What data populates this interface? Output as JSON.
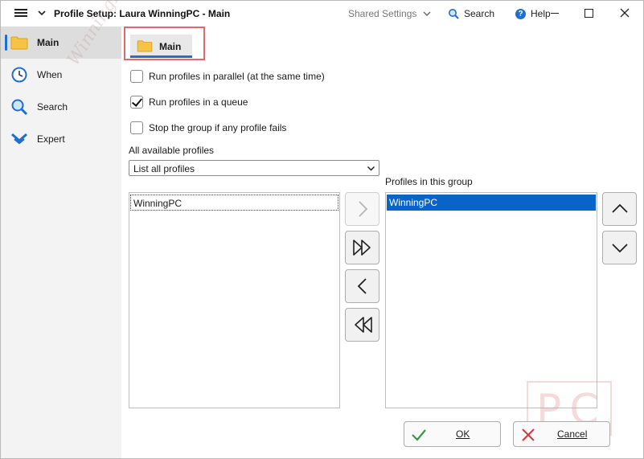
{
  "window": {
    "title": "Profile Setup: Laura WinningPC - Main",
    "shared_settings": "Shared Settings",
    "search": "Search",
    "help": "Help"
  },
  "sidebar": {
    "watermark": "WinningPC",
    "items": [
      {
        "label": "Main",
        "icon": "folder-icon",
        "active": true
      },
      {
        "label": "When",
        "icon": "clock-icon",
        "active": false
      },
      {
        "label": "Search",
        "icon": "magnifier-icon",
        "active": false
      },
      {
        "label": "Expert",
        "icon": "double-chevron-down-icon",
        "active": false
      }
    ]
  },
  "tab": {
    "label": "Main"
  },
  "options": {
    "parallel": {
      "label": "Run profiles in parallel (at the same time)",
      "checked": false
    },
    "queue": {
      "label": "Run profiles in a queue",
      "checked": true
    },
    "stop_on_fail": {
      "label": "Stop the group if any profile fails",
      "checked": false
    }
  },
  "available": {
    "label": "All available profiles",
    "filter_value": "List all profiles",
    "items": [
      "WinningPC"
    ]
  },
  "group": {
    "label": "Profiles in this group",
    "items": [
      "WinningPC"
    ]
  },
  "buttons": {
    "ok": "OK",
    "cancel": "Cancel"
  },
  "watermark_logo": "PC",
  "colors": {
    "accent": "#1f6fd1",
    "selection": "#0a64c8",
    "highlight_box": "#e06a6a",
    "ok_check": "#2e9e3a",
    "cancel_x": "#d9363e"
  }
}
